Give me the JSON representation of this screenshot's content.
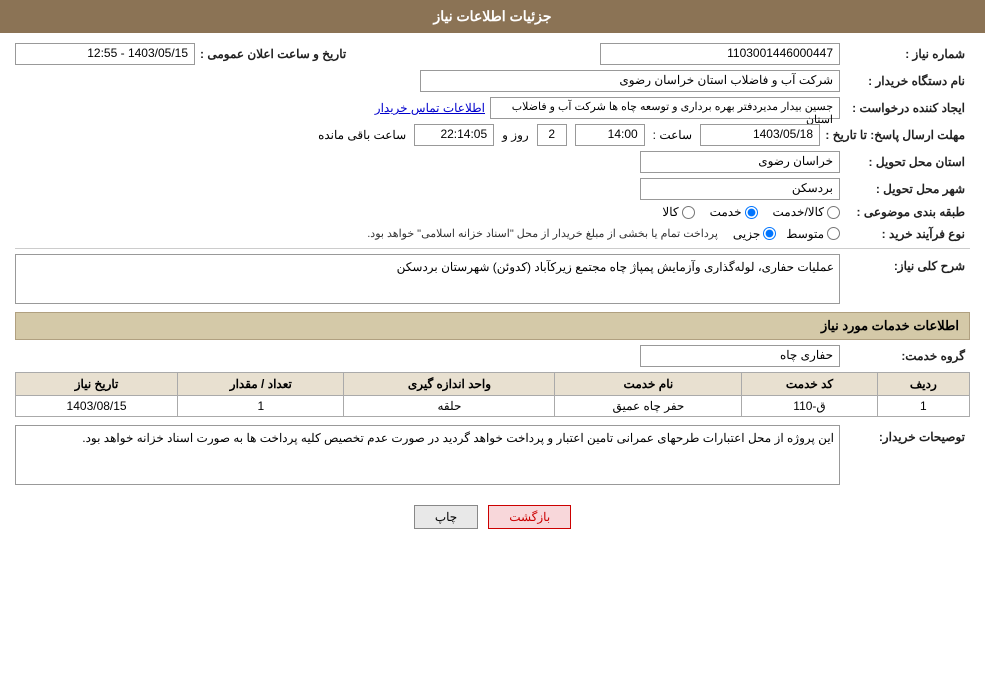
{
  "page": {
    "title": "جزئیات اطلاعات نیاز"
  },
  "fields": {
    "shomara_niaz_label": "شماره نیاز :",
    "shomara_niaz_value": "1103001446000447",
    "nam_dastgah_label": "نام دستگاه خریدار :",
    "nam_dastgah_value": "شرکت آب و فاضلاب استان خراسان رضوی",
    "tarikh_label": "تاریخ و ساعت اعلان عمومی :",
    "tarikh_value": "1403/05/15 - 12:55",
    "ijad_konande_label": "ایجاد کننده درخواست :",
    "ijad_konande_value": "جسین  بیدار مدیردفتر بهره برداری و توسعه چاه ها شرکت آب و فاضلاب استان",
    "ettelaat_tamas": "اطلاعات تماس خریدار",
    "mohlat_ersal_label": "مهلت ارسال پاسخ: تا تاریخ :",
    "date_value": "1403/05/18",
    "saaat_label": "ساعت :",
    "saat_value": "14:00",
    "rooz_label": "روز و",
    "rooz_value": "2",
    "baqi_mande_label": "ساعت باقی مانده",
    "baqi_mande_value": "22:14:05",
    "ostan_tahvil_label": "استان محل تحویل :",
    "ostan_tahvil_value": "خراسان رضوی",
    "shahr_tahvil_label": "شهر محل تحویل :",
    "shahr_tahvil_value": "بردسکن",
    "tabaghebandi_label": "طبقه بندی موضوعی :",
    "radio_kala": "کالا",
    "radio_khadamat": "خدمت",
    "radio_kala_khadamat": "کالا/خدمت",
    "radio_selected": "khadamat",
    "nooe_farayand_label": "نوع فرآیند خرید :",
    "radio_jozei": "جزیی",
    "radio_motovaset": "متوسط",
    "farayand_note": "پرداخت تمام یا بخشی از مبلغ خریدار از محل \"اسناد خزانه اسلامی\" خواهد بود.",
    "sharh_label": "شرح کلی نیاز:",
    "sharh_value": "عملیات حفاری، لوله‌گذاری وآزمایش پمپاژ چاه مجتمع زیرکآباد (کدوئن) شهرستان بردسکن",
    "section2_title": "اطلاعات خدمات مورد نیاز",
    "gorooh_khadamat_label": "گروه خدمت:",
    "gorooh_khadamat_value": "حفاری چاه",
    "table": {
      "headers": [
        "ردیف",
        "کد خدمت",
        "نام خدمت",
        "واحد اندازه گیری",
        "تعداد / مقدار",
        "تاریخ نیاز"
      ],
      "rows": [
        {
          "radif": "1",
          "kod": "ق-110",
          "nam": "حفر چاه عمیق",
          "vahed": "حلقه",
          "tedad": "1",
          "tarikh": "1403/08/15"
        }
      ]
    },
    "tosifat_label": "توصیحات خریدار:",
    "tosifat_value": "این پروژه از محل اعتبارات طرحهای عمرانی تامین اعتبار و پرداخت خواهد گردید در صورت عدم تخصیص کلیه پرداخت ها به صورت اسناد خزانه خواهد بود.",
    "btn_chap": "چاپ",
    "btn_bazgasht": "بازگشت"
  }
}
